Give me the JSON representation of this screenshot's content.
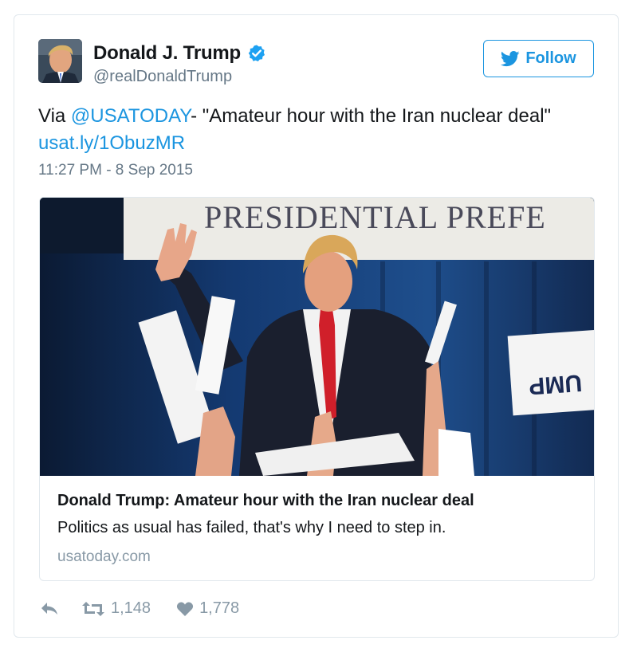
{
  "user": {
    "display_name": "Donald J. Trump",
    "handle": "@realDonaldTrump",
    "verified": true
  },
  "follow_button": {
    "label": "Follow"
  },
  "tweet": {
    "prefix": "Via ",
    "mention": "@USATODAY",
    "text": "- \"Amateur hour with the Iran nuclear deal\"",
    "link": "usat.ly/1ObuzMR",
    "timestamp": "11:27 PM - 8 Sep 2015"
  },
  "card": {
    "image_banner_text": "PRESIDENTIAL PREFE",
    "title": "Donald Trump: Amateur hour with the Iran nuclear deal",
    "description": "Politics as usual has failed, that's why I need to step in.",
    "domain": "usatoday.com"
  },
  "actions": {
    "retweets": "1,148",
    "likes": "1,778"
  },
  "colors": {
    "link_blue": "#1b95e0",
    "muted_gray": "#657786",
    "border": "#e1e8ed"
  }
}
